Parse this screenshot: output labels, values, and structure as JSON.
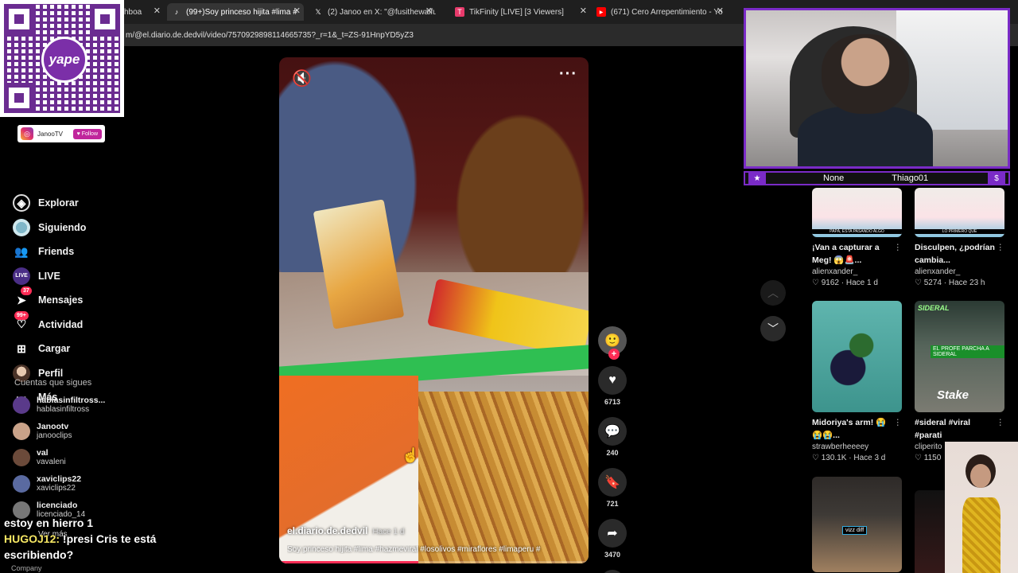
{
  "browser": {
    "tabs": [
      {
        "label": "hboa",
        "icon": "",
        "active": false
      },
      {
        "label": "(99+)Soy princeso hijita #lima #",
        "icon": "tiktok-icon",
        "active": true
      },
      {
        "label": "(2) Janoo en X: \"@fusithewaifu",
        "icon": "x-icon",
        "active": false
      },
      {
        "label": "TikFinity [LIVE] [3 Viewers]",
        "icon": "tikfinity-icon",
        "active": false
      },
      {
        "label": "(671) Cero Arrepentimiento - Yo",
        "icon": "youtube-icon",
        "active": false
      }
    ],
    "url": "m/@el.diario.de.dedvil/video/7570929898114665735?_r=1&_t=ZS-91HnpYD5yZ3"
  },
  "overlay": {
    "qr_brand": "yape",
    "social_name": "JanooTV",
    "social_follow": "Follow"
  },
  "nav": {
    "items": [
      {
        "label": "Explorar",
        "icon": "compass-icon"
      },
      {
        "label": "Siguiendo",
        "icon": "following-icon"
      },
      {
        "label": "Friends",
        "icon": "friends-icon"
      },
      {
        "label": "LIVE",
        "icon": "live-icon"
      },
      {
        "label": "Mensajes",
        "icon": "messages-icon",
        "badge": "37"
      },
      {
        "label": "Actividad",
        "icon": "activity-icon",
        "badge": "99+"
      },
      {
        "label": "Cargar",
        "icon": "upload-icon"
      },
      {
        "label": "Perfil",
        "icon": "profile-icon"
      },
      {
        "label": "Más",
        "icon": "more-icon"
      }
    ]
  },
  "following": {
    "title": "Cuentas que sigues",
    "accounts": [
      {
        "name": "hablasinfiltross...",
        "user": "hablasinfiltross",
        "color": "#5a3a8a"
      },
      {
        "name": "Janootv",
        "user": "janooclips",
        "color": "#c9a289"
      },
      {
        "name": "val",
        "user": "vavaleni",
        "color": "#6b4a3a"
      },
      {
        "name": "xaviclips22",
        "user": "xaviclips22",
        "color": "#5a6aa0"
      },
      {
        "name": "licenciado",
        "user": "licenciado_14",
        "color": "#777777"
      }
    ],
    "see_more": "Ver más",
    "company": "Company"
  },
  "chat": {
    "line1": "estoy en hierro 1",
    "user": "HUGOJ12:",
    "message": "!presi Cris te está escribiendo?"
  },
  "video": {
    "author": "el.diario.de.dedvil",
    "date": "Hace 1 d",
    "caption": "Soy princeso hijita #lima #hazmeviral #losolivos #miraflores #limaperu #",
    "progress": 0.45,
    "likes": "6713",
    "comments": "240",
    "saves": "721",
    "shares": "3470"
  },
  "webcam": {
    "left_label": "None",
    "right_label": "Thiago01"
  },
  "grid": [
    {
      "title": "¡Van a capturar a Meg! 😱🚨...",
      "user": "alienxander_",
      "likes": "9162",
      "time": "Hace 1 d",
      "thumb_text": "PAPÁ, ESTA PASANDO ALGO"
    },
    {
      "title": "Disculpen, ¿podrían cambia...",
      "user": "alienxander_",
      "likes": "5274",
      "time": "Hace 23 h",
      "thumb_text": "LO PRIMERO QUE"
    },
    {
      "title": "Midoriya's arm! 😭 😭😭...",
      "user": "strawberheeeey",
      "likes": "130.1K",
      "time": "Hace 3 d"
    },
    {
      "title": "#sideral #viral #parati",
      "user": "cliperito",
      "likes": "1150",
      "time": "",
      "thumb_top": "SIDERAL",
      "thumb_mid": "EL PROFE PARCHA A SIDERAL",
      "thumb_logo": "Stake"
    },
    {
      "title": "",
      "user": "",
      "likes": "",
      "time": "",
      "thumb_text": "vizz diff"
    },
    {
      "title": "",
      "user": "",
      "likes": "",
      "time": ""
    }
  ]
}
